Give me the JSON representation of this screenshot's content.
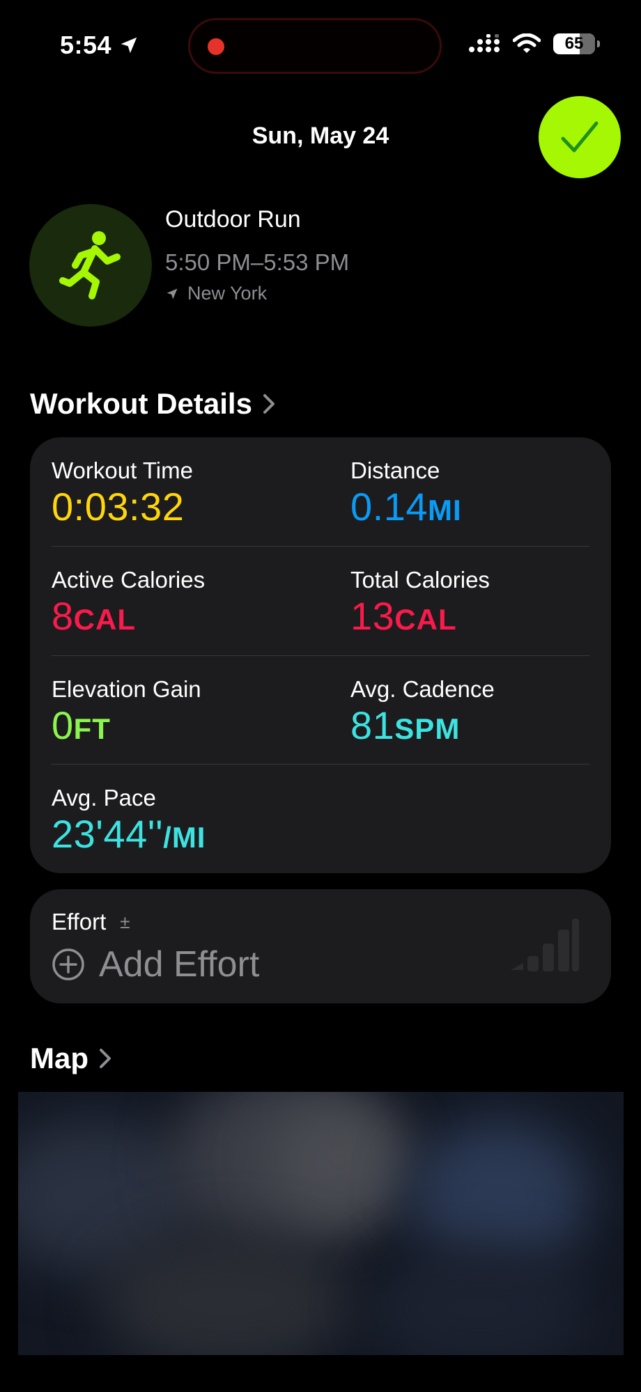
{
  "status_bar": {
    "time": "5:54",
    "battery": "65"
  },
  "header": {
    "date": "Sun, May 24"
  },
  "workout": {
    "name": "Outdoor Run",
    "time_range": "5:50 PM–5:53 PM",
    "location": "New York"
  },
  "details": {
    "title": "Workout Details",
    "metrics": [
      {
        "label": "Workout Time",
        "value": "0:03:32",
        "unit": "",
        "color": "#ffd60a"
      },
      {
        "label": "Distance",
        "value": "0.14",
        "unit": "MI",
        "color": "#0a9bf5"
      },
      {
        "label": "Active Calories",
        "value": "8",
        "unit": "CAL",
        "color": "#fa1a4b"
      },
      {
        "label": "Total Calories",
        "value": "13",
        "unit": "CAL",
        "color": "#fa1a4b"
      },
      {
        "label": "Elevation Gain",
        "value": "0",
        "unit": "FT",
        "color": "#8af54d"
      },
      {
        "label": "Avg. Cadence",
        "value": "81",
        "unit": "SPM",
        "color": "#3ce3e1"
      },
      {
        "label": "Avg. Pace",
        "value": "23'44''",
        "unit": "/MI",
        "color": "#3ce3e1"
      }
    ]
  },
  "effort": {
    "label": "Effort",
    "adjust_symbol": "±",
    "add_label": "Add Effort"
  },
  "map": {
    "title": "Map"
  },
  "colors": {
    "accent_green": "#a6f703",
    "card_bg": "#1c1c1e",
    "secondary_text": "#8e8e93"
  }
}
